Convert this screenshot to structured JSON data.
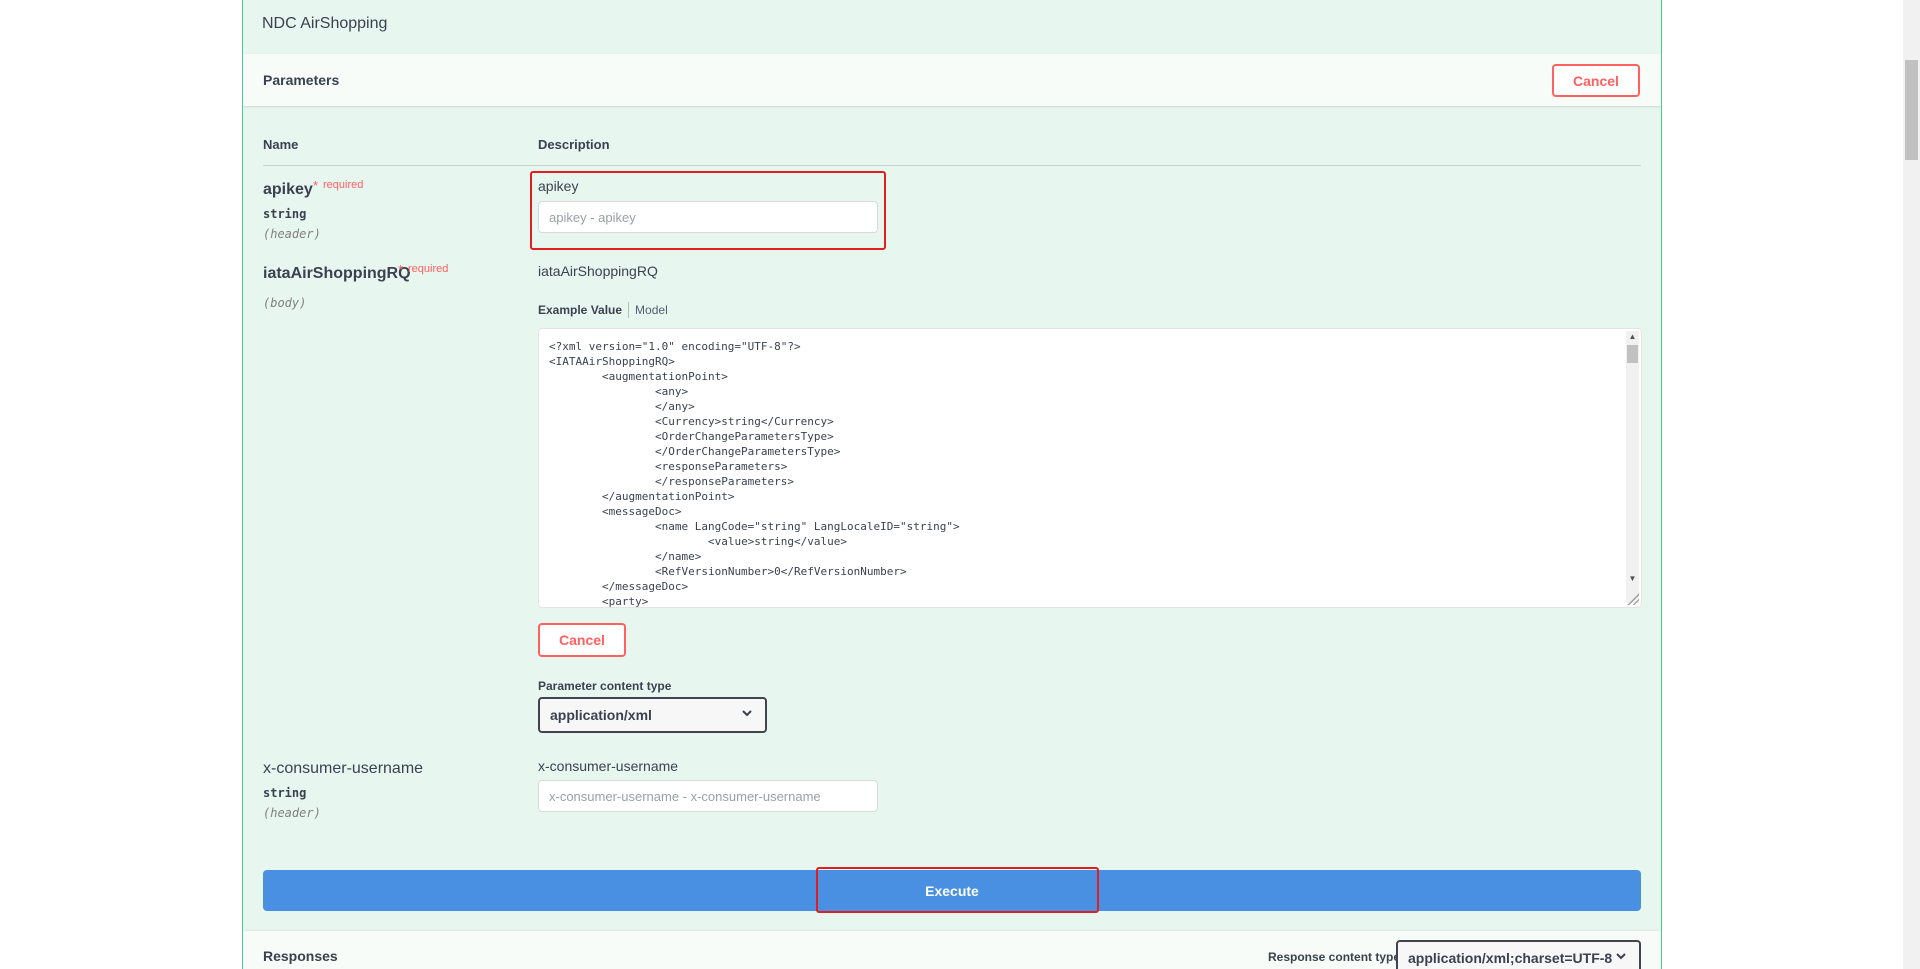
{
  "operation": {
    "summary": "NDC AirShopping"
  },
  "parameters": {
    "title": "Parameters",
    "cancel_label": "Cancel",
    "columns": {
      "name": "Name",
      "description": "Description"
    },
    "items": [
      {
        "name": "apikey",
        "required_star": "*",
        "required_label": "required",
        "type": "string",
        "in": "(header)",
        "description": "apikey",
        "placeholder": "apikey - apikey"
      },
      {
        "name": "iataAirShoppingRQ",
        "required_star": "*",
        "required_label": "required",
        "in": "(body)",
        "description": "iataAirShoppingRQ",
        "tabs": {
          "example": "Example Value",
          "model": "Model"
        },
        "example_xml": "<?xml version=\"1.0\" encoding=\"UTF-8\"?>\n<IATAAirShoppingRQ>\n\t<augmentationPoint>\n\t\t<any>\n\t\t</any>\n\t\t<Currency>string</Currency>\n\t\t<OrderChangeParametersType>\n\t\t</OrderChangeParametersType>\n\t\t<responseParameters>\n\t\t</responseParameters>\n\t</augmentationPoint>\n\t<messageDoc>\n\t\t<name LangCode=\"string\" LangLocaleID=\"string\">\n\t\t\t<value>string</value>\n\t\t</name>\n\t\t<RefVersionNumber>0</RefVersionNumber>\n\t</messageDoc>\n\t<party>",
        "cancel_label": "Cancel",
        "content_type_label": "Parameter content type",
        "content_type_value": "application/xml"
      },
      {
        "name": "x-consumer-username",
        "type": "string",
        "in": "(header)",
        "description": "x-consumer-username",
        "placeholder": "x-consumer-username - x-consumer-username"
      }
    ]
  },
  "execute_label": "Execute",
  "responses": {
    "title": "Responses",
    "content_type_label": "Response content type",
    "content_type_value": "application/xml;charset=UTF-8"
  },
  "colors": {
    "accent_green": "#49cc90",
    "block_background": "#e8f6f0",
    "execute_blue": "#4990e2",
    "cancel_red": "#ff6060",
    "highlight_red": "#e02020"
  },
  "icons": {
    "select_chevron": "chevron-down-icon",
    "scroll_up": "scroll-up-arrow-icon",
    "scroll_down": "scroll-down-arrow-icon",
    "resize": "resize-grip-icon"
  }
}
